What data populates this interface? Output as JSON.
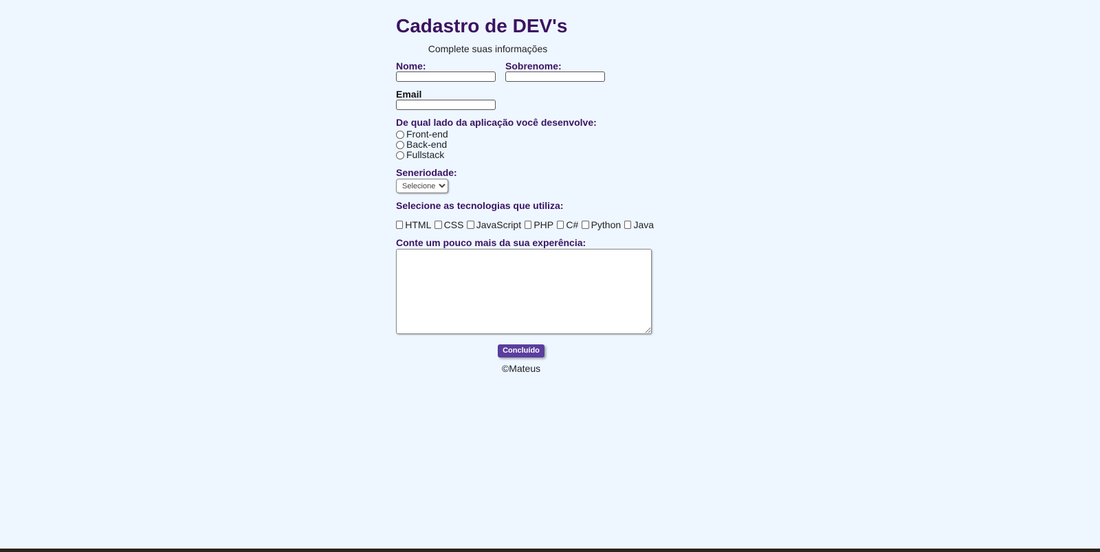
{
  "page": {
    "title": "Cadastro de DEV's",
    "subtitle": "Complete suas informações"
  },
  "form": {
    "nome_label": "Nome:",
    "nome_value": "",
    "sobrenome_label": "Sobrenome:",
    "sobrenome_value": "",
    "email_label": "Email",
    "email_value": "",
    "lado_label": "De qual lado da aplicação você desenvolve:",
    "lado_options": [
      "Front-end",
      "Back-end",
      "Fullstack"
    ],
    "senioridade_label": "Seneriodade:",
    "senioridade_selected": "Selecione",
    "tecnologias_label": "Selecione as tecnologias que utiliza:",
    "tecnologias_options": [
      "HTML",
      "CSS",
      "JavaScript",
      "PHP",
      "C#",
      "Python",
      "Java"
    ],
    "experiencia_label": "Conte um pouco mais da sua experência:",
    "experiencia_value": "",
    "submit_label": "Concluído"
  },
  "footer": {
    "text": "©Mateus"
  },
  "colors": {
    "background": "#eef6ff",
    "heading": "#3b1360",
    "button": "#5a3d9e"
  }
}
